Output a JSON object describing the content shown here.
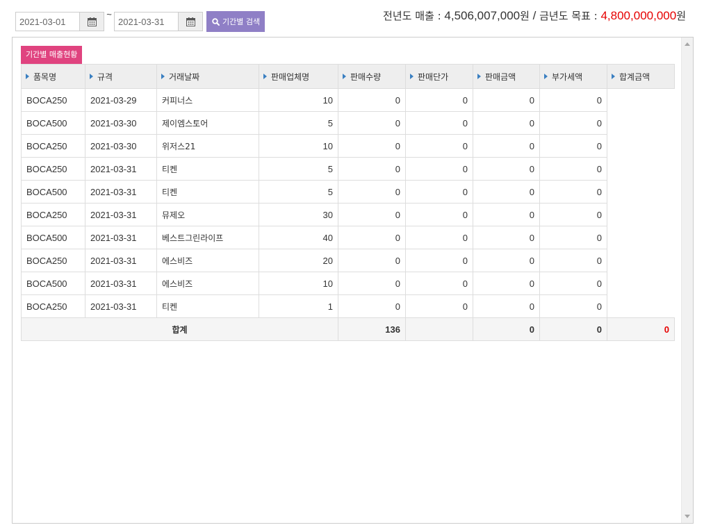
{
  "search": {
    "start_date": "2021-03-01",
    "end_date": "2021-03-31",
    "separator": "~",
    "button_label": "기간별 검색"
  },
  "summary": {
    "prev_label": "전년도 매출 : ",
    "prev_value": "4,506,007,000",
    "prev_unit": "원",
    "divider": " / ",
    "goal_label": "금년도 목표 : ",
    "goal_value": "4,800,000,000",
    "goal_unit": "원"
  },
  "section": {
    "title": "기간별 매출현황"
  },
  "table": {
    "columns": [
      "품목명",
      "규격",
      "거래날짜",
      "판매업체명",
      "판매수량",
      "판매단가",
      "판매금액",
      "부가세액",
      "합계금액"
    ],
    "rows": [
      [
        "BOCA250",
        "2021-03-29",
        "커피너스",
        "10",
        "0",
        "0",
        "0",
        "0"
      ],
      [
        "BOCA500",
        "2021-03-30",
        "제이엠스토어",
        "5",
        "0",
        "0",
        "0",
        "0"
      ],
      [
        "BOCA250",
        "2021-03-30",
        "위저스21",
        "10",
        "0",
        "0",
        "0",
        "0"
      ],
      [
        "BOCA250",
        "2021-03-31",
        "티켄",
        "5",
        "0",
        "0",
        "0",
        "0"
      ],
      [
        "BOCA500",
        "2021-03-31",
        "티켄",
        "5",
        "0",
        "0",
        "0",
        "0"
      ],
      [
        "BOCA250",
        "2021-03-31",
        "뮤제오",
        "30",
        "0",
        "0",
        "0",
        "0"
      ],
      [
        "BOCA500",
        "2021-03-31",
        "베스트그린라이프",
        "40",
        "0",
        "0",
        "0",
        "0"
      ],
      [
        "BOCA250",
        "2021-03-31",
        "에스비즈",
        "20",
        "0",
        "0",
        "0",
        "0"
      ],
      [
        "BOCA500",
        "2021-03-31",
        "에스비즈",
        "10",
        "0",
        "0",
        "0",
        "0"
      ],
      [
        "BOCA250",
        "2021-03-31",
        "티켄",
        "1",
        "0",
        "0",
        "0",
        "0"
      ]
    ],
    "total": {
      "label": "합계",
      "quantity": "136",
      "sales_amount": "0",
      "vat": "0",
      "grand_total": "0"
    }
  },
  "colors": {
    "search_button": "#8f7fc6",
    "section_tag": "#e0437f",
    "highlight_red": "#e60000",
    "header_arrow": "#3a7fc1"
  },
  "icons": {
    "calendar": "calendar-icon",
    "search": "search-icon",
    "header_marker": "triangle-right-icon"
  }
}
